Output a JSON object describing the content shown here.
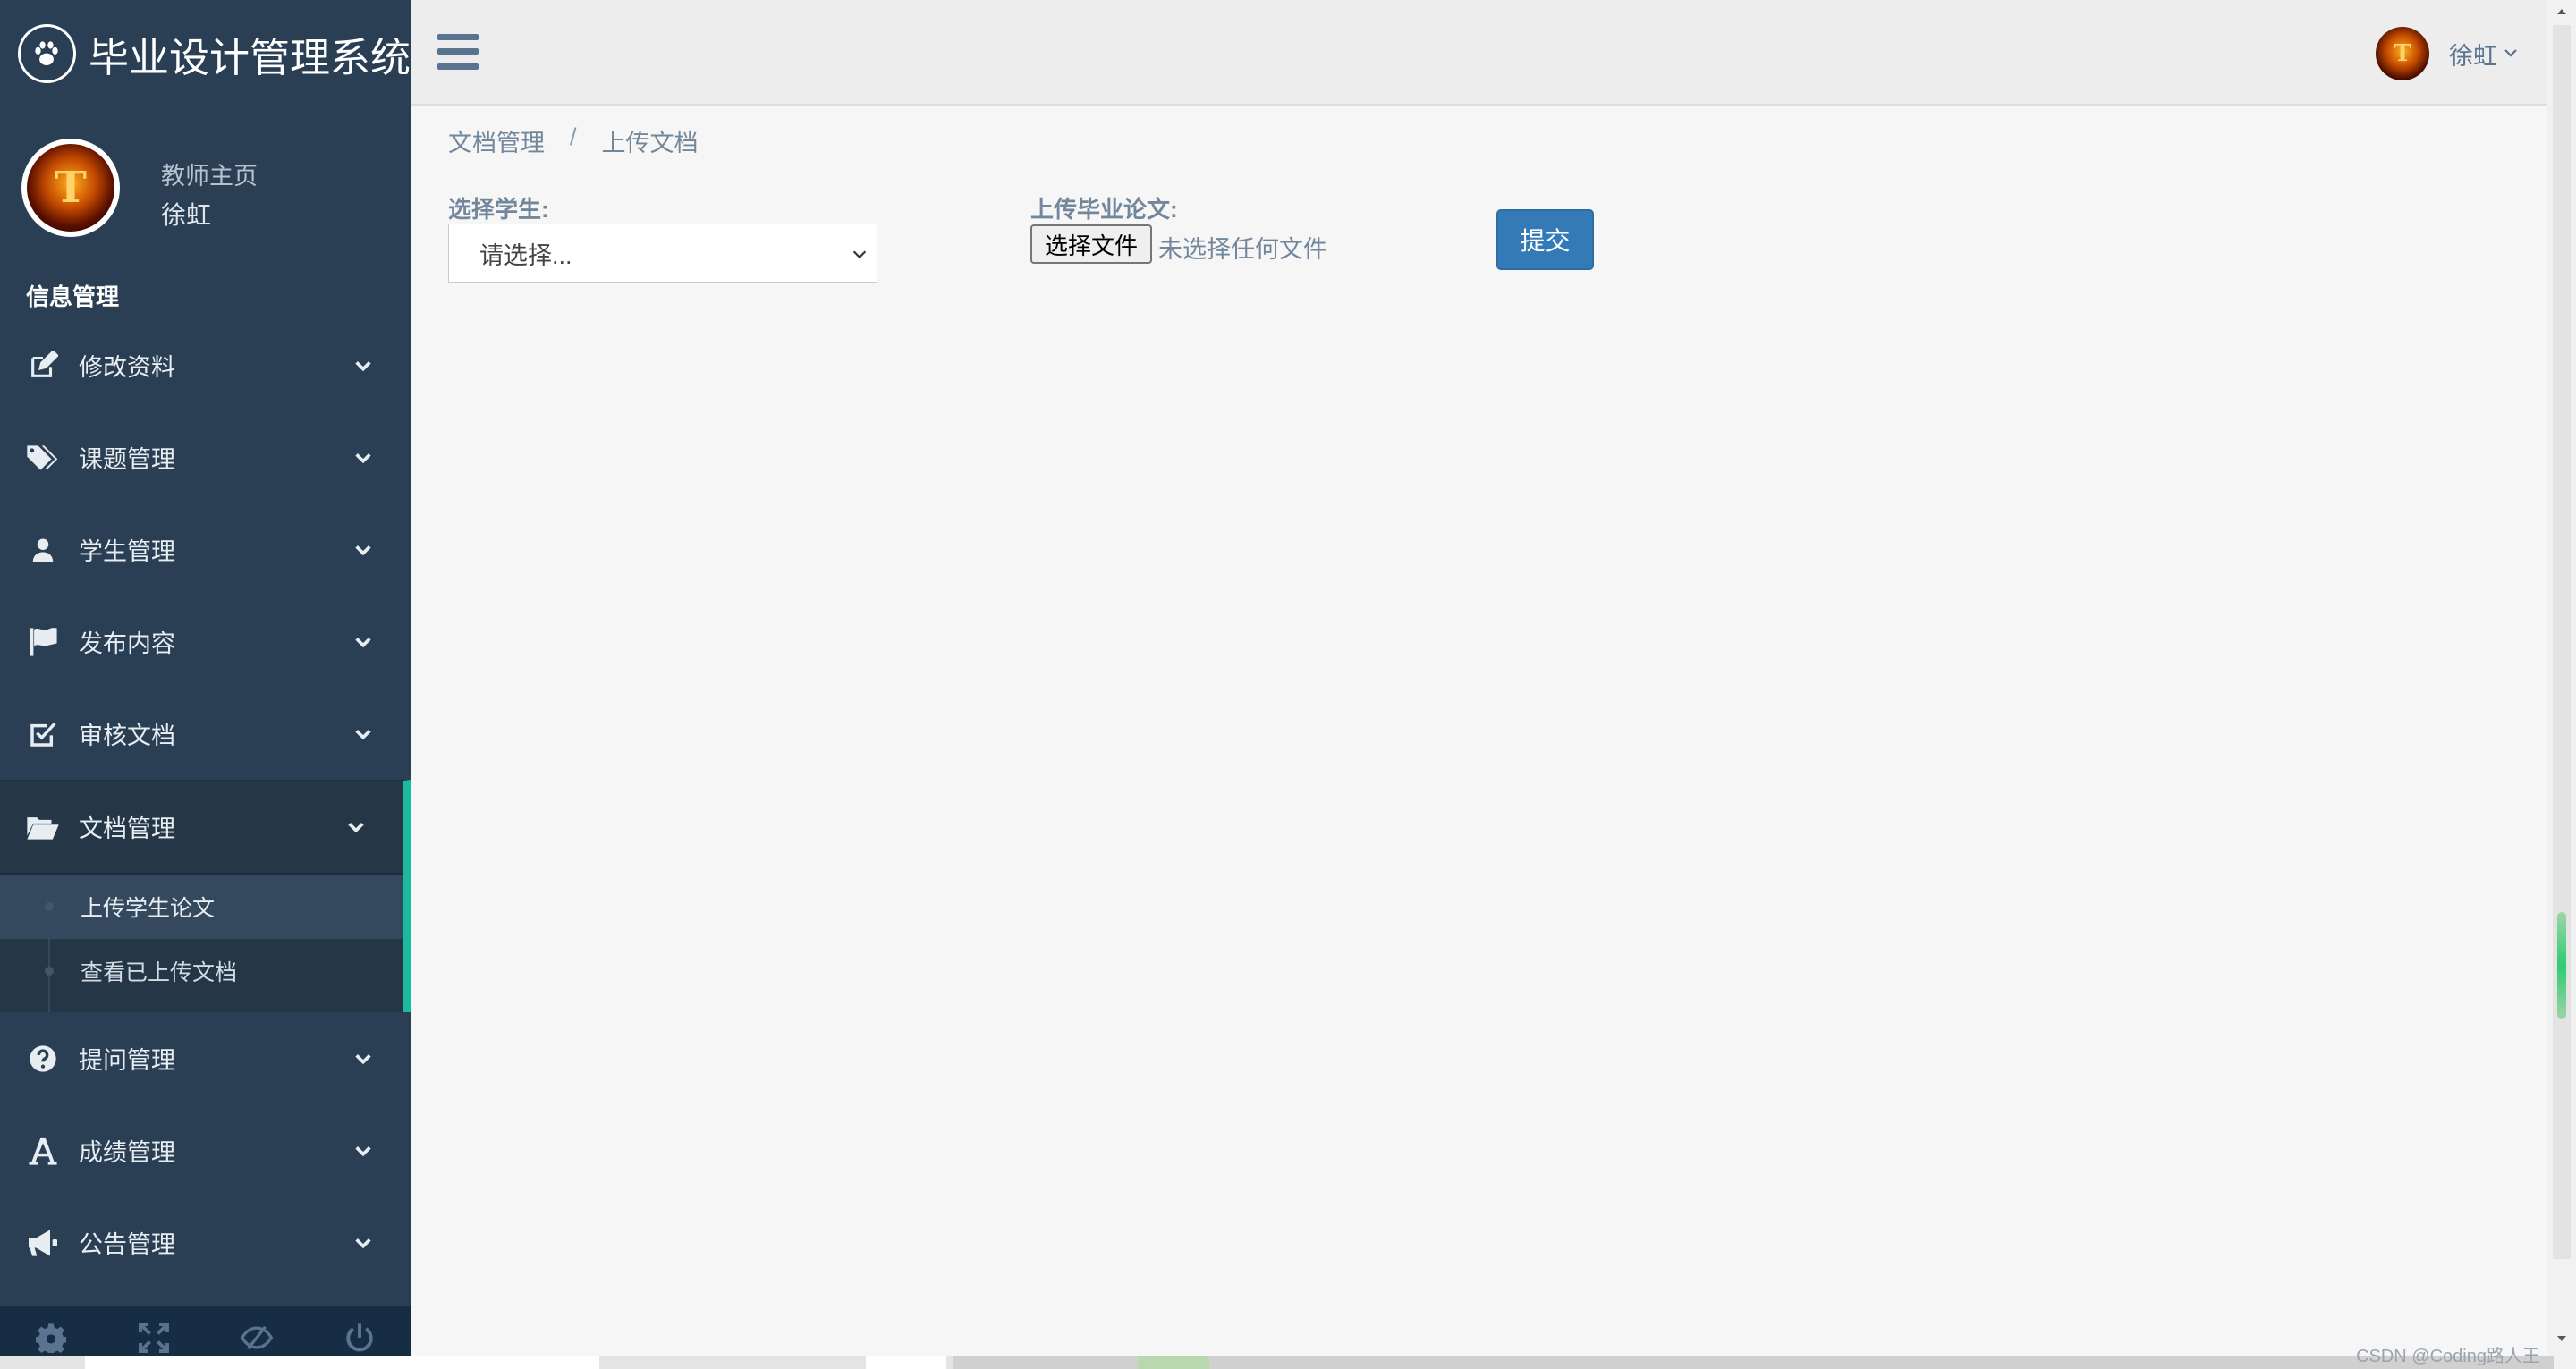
{
  "app": {
    "title": "毕业设计管理系统",
    "logo_icon": "paw-icon"
  },
  "profile": {
    "role": "教师主页",
    "name": "徐虹",
    "avatar_glyph": "T"
  },
  "sidebar": {
    "section_title": "信息管理",
    "items": [
      {
        "label": "修改资料",
        "icon": "edit-icon"
      },
      {
        "label": "课题管理",
        "icon": "tags-icon"
      },
      {
        "label": "学生管理",
        "icon": "user-icon"
      },
      {
        "label": "发布内容",
        "icon": "flag-icon"
      },
      {
        "label": "审核文档",
        "icon": "check-square-icon"
      },
      {
        "label": "文档管理",
        "icon": "folder-open-icon",
        "expanded": true
      },
      {
        "label": "提问管理",
        "icon": "question-circle-icon"
      },
      {
        "label": "成绩管理",
        "icon": "font-icon"
      },
      {
        "label": "公告管理",
        "icon": "bullhorn-icon"
      }
    ],
    "submenu": [
      {
        "label": "上传学生论文",
        "current": true
      },
      {
        "label": "查看已上传文档",
        "current": false
      }
    ],
    "footer_buttons": [
      "settings-icon",
      "fullscreen-icon",
      "lock-icon",
      "logout-icon"
    ]
  },
  "topbar": {
    "user_name": "徐虹",
    "avatar_glyph": "T"
  },
  "breadcrumb": {
    "parent": "文档管理",
    "separator": "/",
    "current": "上传文档"
  },
  "form": {
    "student_label": "选择学生:",
    "student_select_value": "请选择...",
    "upload_label": "上传毕业论文:",
    "file_button": "选择文件",
    "file_status": "未选择任何文件",
    "submit": "提交"
  },
  "watermark": "CSDN @Coding路人王",
  "colors": {
    "sidebar_bg": "#2a3f54",
    "accent_green": "#1abb9c",
    "primary_blue": "#337ab7",
    "text_muted": "#73879c"
  }
}
